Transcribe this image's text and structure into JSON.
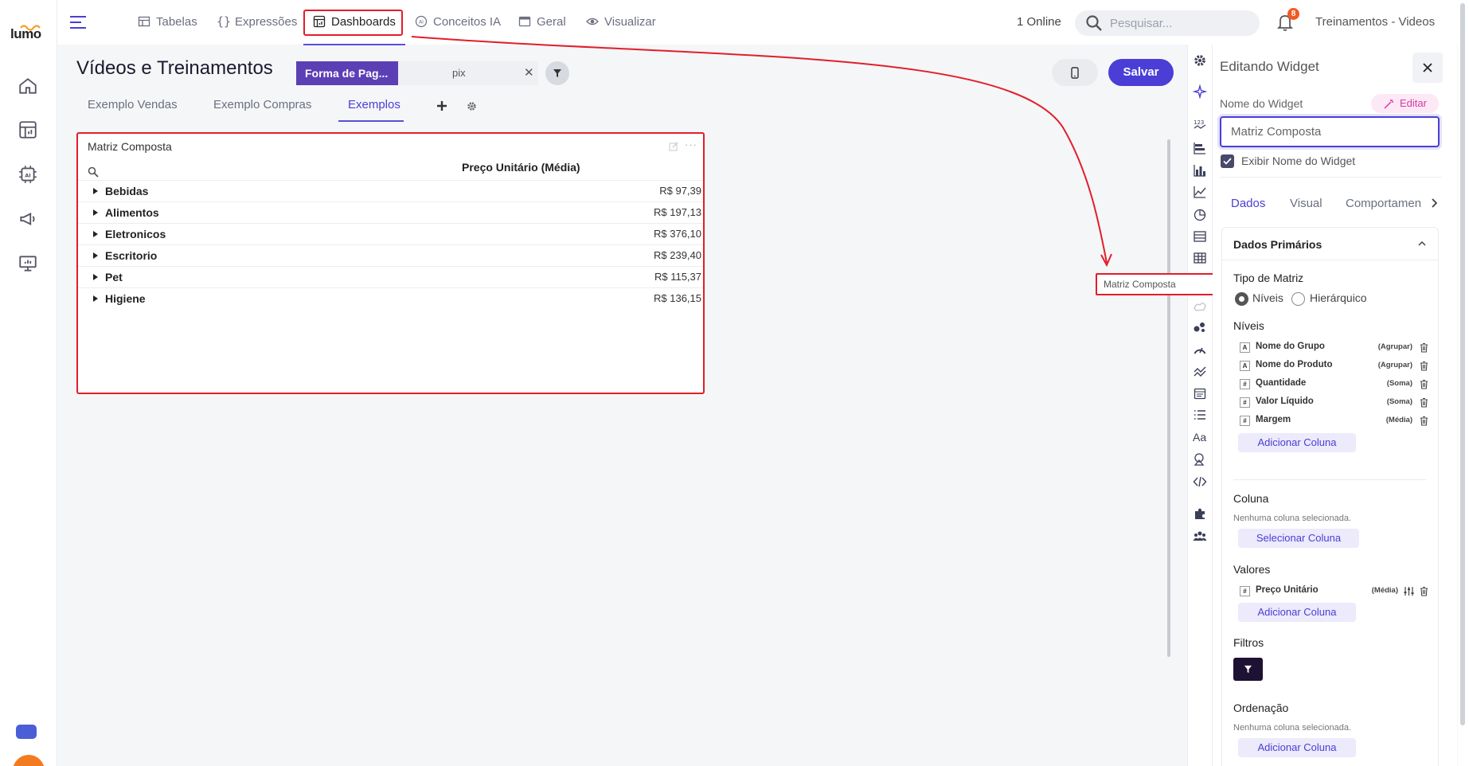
{
  "app": {
    "logo_text": "lumo"
  },
  "nav": {
    "items": [
      {
        "label": "Tabelas",
        "icon": "table-icon"
      },
      {
        "label": "Expressões",
        "icon": "braces-icon"
      },
      {
        "label": "Dashboards",
        "icon": "dashboard-icon"
      },
      {
        "label": "Conceitos IA",
        "icon": "ai-icon"
      },
      {
        "label": "Geral",
        "icon": "window-icon"
      },
      {
        "label": "Visualizar",
        "icon": "eye-icon"
      }
    ],
    "active": "Dashboards"
  },
  "topbar": {
    "online": "1 Online",
    "search_placeholder": "Pesquisar...",
    "notifications_count": "8",
    "workspace": "Treinamentos - Videos"
  },
  "header": {
    "title": "Vídeos e Treinamentos",
    "filter_chip": "Forma de Pag...",
    "filter_value": "pix",
    "save_label": "Salvar"
  },
  "tabs": {
    "items": [
      "Exemplo Vendas",
      "Exemplo Compras",
      "Exemplos"
    ],
    "active": "Exemplos"
  },
  "widget": {
    "title": "Matriz Composta",
    "column_header": "Preço Unitário (Média)",
    "rows": [
      {
        "name": "Bebidas",
        "value": "R$ 97,39"
      },
      {
        "name": "Alimentos",
        "value": "R$ 197,13"
      },
      {
        "name": "Eletronicos",
        "value": "R$ 376,10"
      },
      {
        "name": "Escritorio",
        "value": "R$ 239,40"
      },
      {
        "name": "Pet",
        "value": "R$ 115,37"
      },
      {
        "name": "Higiene",
        "value": "R$ 136,15"
      }
    ]
  },
  "tooltip": {
    "text": "Matriz Composta"
  },
  "panel": {
    "title": "Editando Widget",
    "name_label": "Nome do Widget",
    "edit_chip": "Editar",
    "name_value": "Matriz Composta",
    "show_name_label": "Exibir Nome do Widget",
    "show_name_checked": true,
    "tabs": [
      "Dados",
      "Visual",
      "Comportamen"
    ],
    "active_tab": "Dados",
    "section_title": "Dados Primários",
    "matrix_type_label": "Tipo de Matriz",
    "matrix_types": [
      "Níveis",
      "Hierárquico"
    ],
    "matrix_type_selected": "Níveis",
    "levels_label": "Níveis",
    "levels": [
      {
        "type": "A",
        "name": "Nome do Grupo",
        "agg": "(Agrupar)"
      },
      {
        "type": "A",
        "name": "Nome do Produto",
        "agg": "(Agrupar)"
      },
      {
        "type": "#",
        "name": "Quantidade",
        "agg": "(Soma)"
      },
      {
        "type": "#",
        "name": "Valor Líquido",
        "agg": "(Soma)"
      },
      {
        "type": "#",
        "name": "Margem",
        "agg": "(Média)"
      }
    ],
    "add_column": "Adicionar Coluna",
    "column_label": "Coluna",
    "no_column": "Nenhuma coluna selecionada.",
    "select_column": "Selecionar Coluna",
    "values_label": "Valores",
    "values": [
      {
        "type": "#",
        "name": "Preço Unitário",
        "agg": "(Média)"
      }
    ],
    "filters_label": "Filtros",
    "order_label": "Ordenação"
  },
  "colors": {
    "accent": "#4a3ed6",
    "highlight": "#e21e2a",
    "chip": "#5b3fb5"
  }
}
